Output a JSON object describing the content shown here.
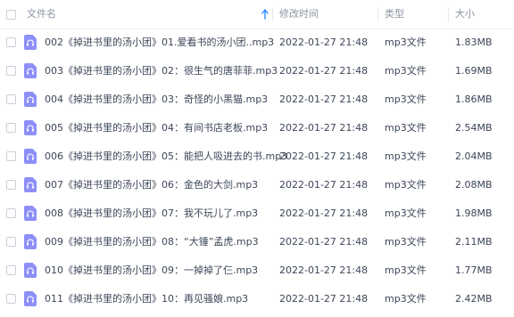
{
  "header": {
    "name_label": "文件名",
    "time_label": "修改时间",
    "type_label": "类型",
    "size_label": "大小"
  },
  "files": [
    {
      "name": "002《掉进书里的汤小团》01.爱看书的汤小团..mp3",
      "time": "2022-01-27 21:48",
      "type": "mp3文件",
      "size": "1.83MB"
    },
    {
      "name": "003《掉进书里的汤小团》02：很生气的唐菲菲.mp3",
      "time": "2022-01-27 21:48",
      "type": "mp3文件",
      "size": "1.69MB"
    },
    {
      "name": "004《掉进书里的汤小团》03：奇怪的小黑猫.mp3",
      "time": "2022-01-27 21:48",
      "type": "mp3文件",
      "size": "1.86MB"
    },
    {
      "name": "005《掉进书里的汤小团》04：有间书店老板.mp3",
      "time": "2022-01-27 21:48",
      "type": "mp3文件",
      "size": "2.54MB"
    },
    {
      "name": "006《掉进书里的汤小团》05：能把人吸进去的书.mp3",
      "time": "2022-01-27 21:48",
      "type": "mp3文件",
      "size": "2.04MB"
    },
    {
      "name": "007《掉进书里的汤小团》06：金色的大剑.mp3",
      "time": "2022-01-27 21:48",
      "type": "mp3文件",
      "size": "2.08MB"
    },
    {
      "name": "008《掉进书里的汤小团》07：我不玩儿了.mp3",
      "time": "2022-01-27 21:48",
      "type": "mp3文件",
      "size": "1.98MB"
    },
    {
      "name": "009《掉进书里的汤小团》08：“大锤”孟虎.mp3",
      "time": "2022-01-27 21:48",
      "type": "mp3文件",
      "size": "2.11MB"
    },
    {
      "name": "010《掉进书里的汤小团》09：一掉掉了仨.mp3",
      "time": "2022-01-27 21:48",
      "type": "mp3文件",
      "size": "1.77MB"
    },
    {
      "name": "011《掉进书里的汤小团》10：再见骚娘.mp3",
      "time": "2022-01-27 21:48",
      "type": "mp3文件",
      "size": "2.42MB"
    }
  ],
  "colors": {
    "accent": "#2f8bff",
    "icon_bg": "#8d8ff7",
    "header_text": "#8c93a3"
  },
  "icons": {
    "file": "audio-file-icon",
    "sort": "sort-arrow-up-icon"
  }
}
